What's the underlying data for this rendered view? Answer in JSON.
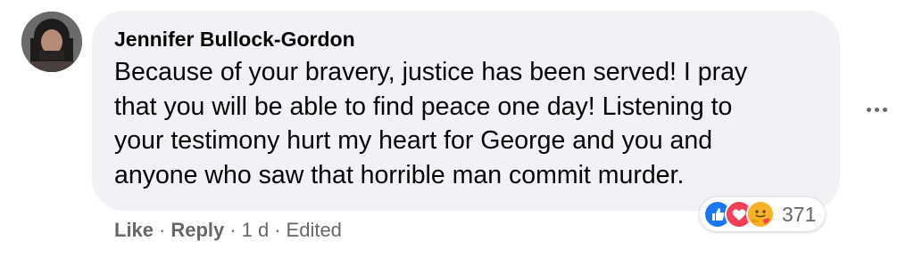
{
  "comment": {
    "author": "Jennifer Bullock-Gordon",
    "text_lines": [
      "Because of your bravery, justice has been served! I pray",
      "that you will be able to find peace one day! Listening to",
      "your testimony hurt my heart for George and you and",
      "anyone who saw that horrible man commit murder."
    ],
    "actions": {
      "like": "Like",
      "separator": "·",
      "reply": "Reply",
      "time": "1 d",
      "edited": "Edited"
    },
    "reactions": {
      "icons": [
        "like-reaction-icon",
        "love-reaction-icon",
        "care-reaction-icon"
      ],
      "count": "371"
    },
    "more_icon": "more-options-icon"
  },
  "colors": {
    "bubble_bg": "#f0f2f5",
    "text": "#050505",
    "secondary_text": "#65676b",
    "like_blue": "#1877f2",
    "love_red": "#f33e58",
    "care_yellow": "#f7b125"
  }
}
